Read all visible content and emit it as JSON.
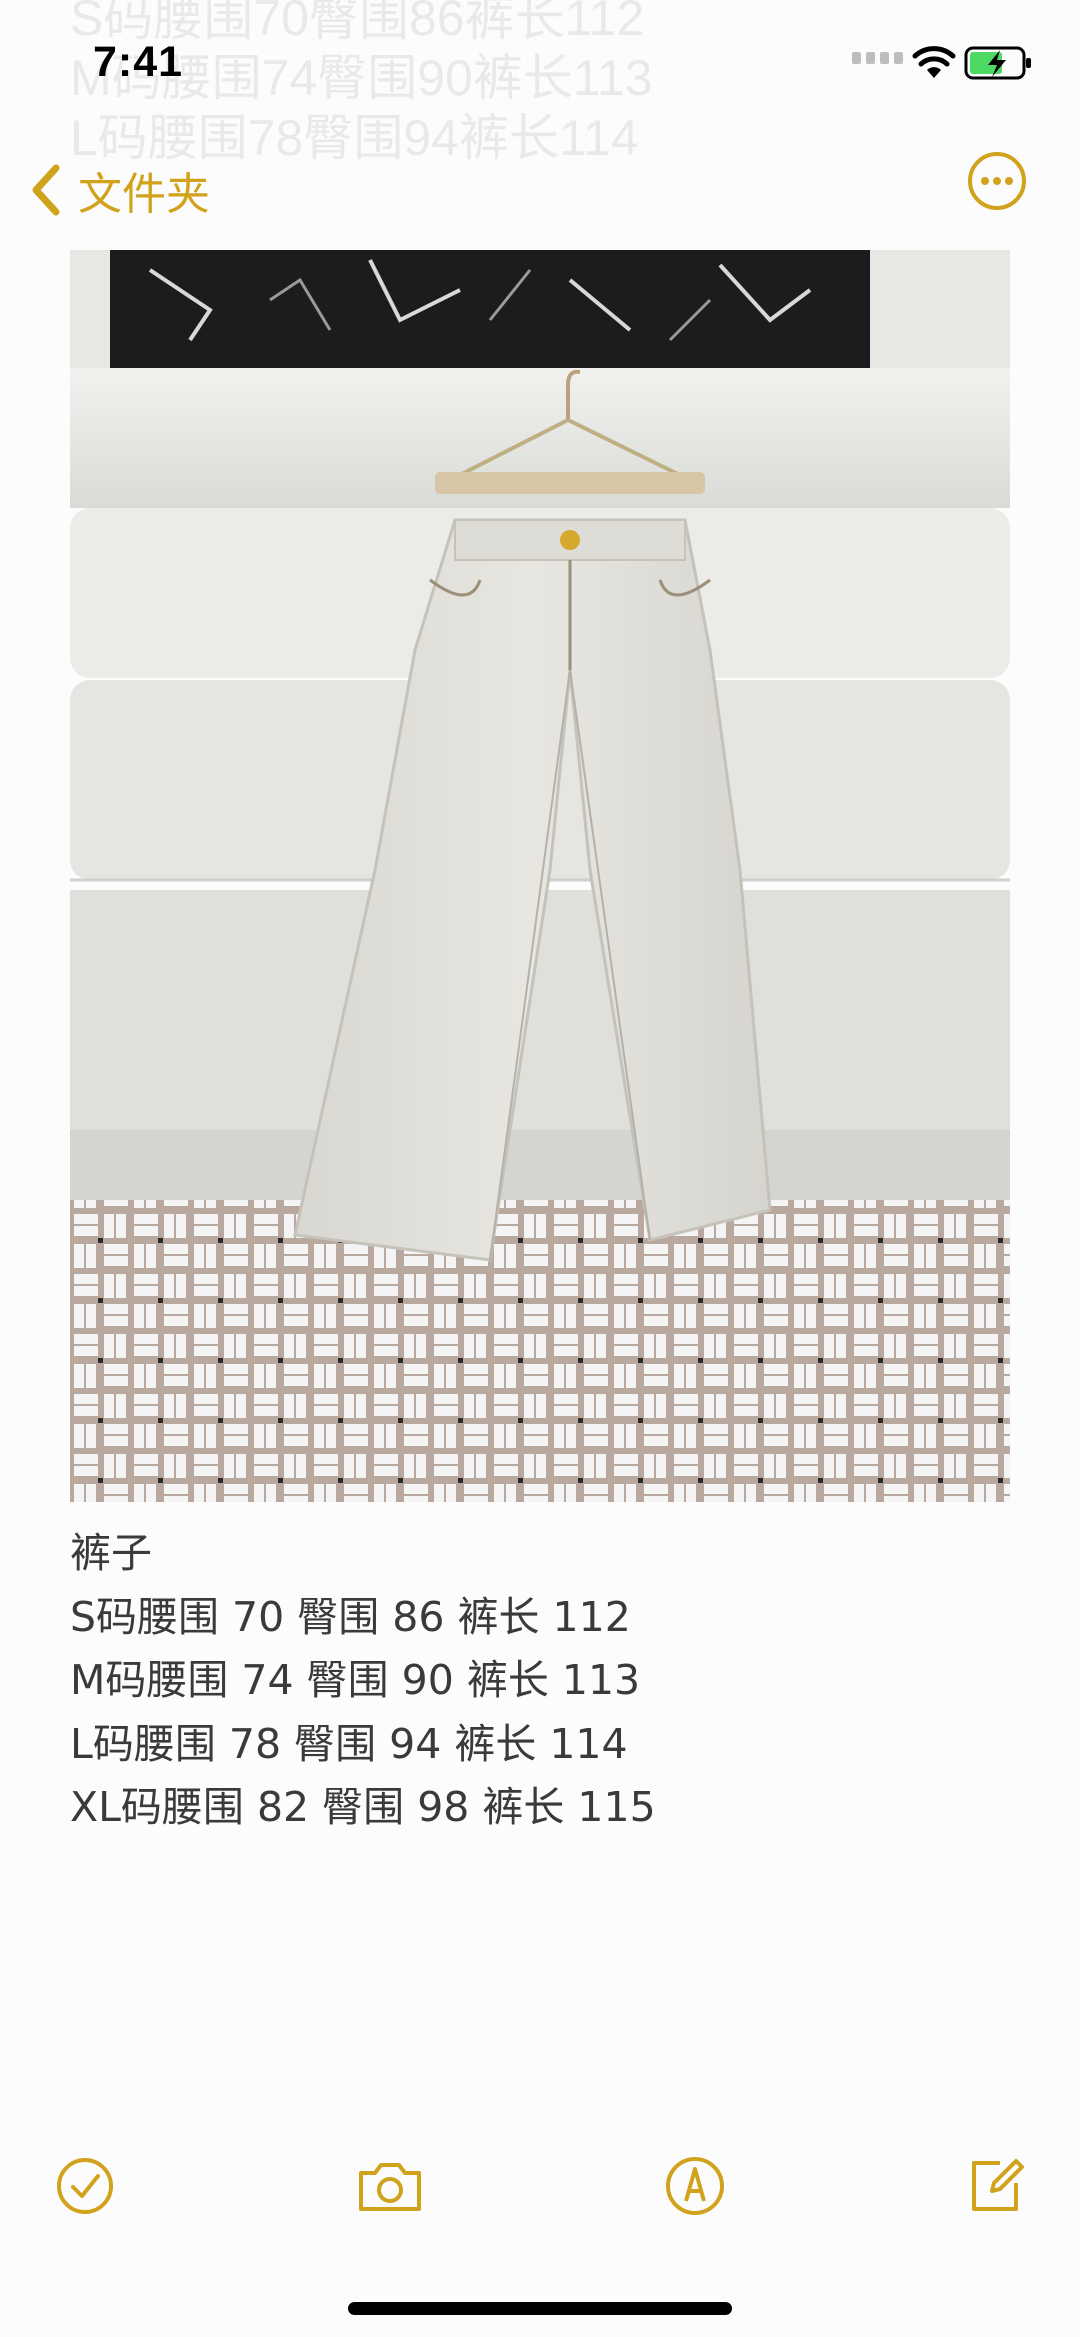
{
  "status_bar": {
    "time": "7:41"
  },
  "ghost_text": "S码腰围70臀围86裤长112\nM码腰围74臀围90裤长113\nL码腰围78臀围94裤长114",
  "nav": {
    "back_label": "文件夹",
    "accent_color": "#d1a21c"
  },
  "photo": {
    "subject": "light grey wide-leg trousers on hanger over white sofa"
  },
  "note": {
    "lines": [
      "裤子",
      "S码腰围 70 臀围 86 裤长 112",
      "M码腰围 74 臀围 90 裤长 113",
      "L码腰围 78 臀围 94 裤长 114",
      "XL码腰围 82 臀围 98 裤长 115"
    ]
  },
  "toolbar": {
    "icons": [
      "checklist-icon",
      "camera-icon",
      "markup-icon",
      "compose-icon"
    ]
  }
}
